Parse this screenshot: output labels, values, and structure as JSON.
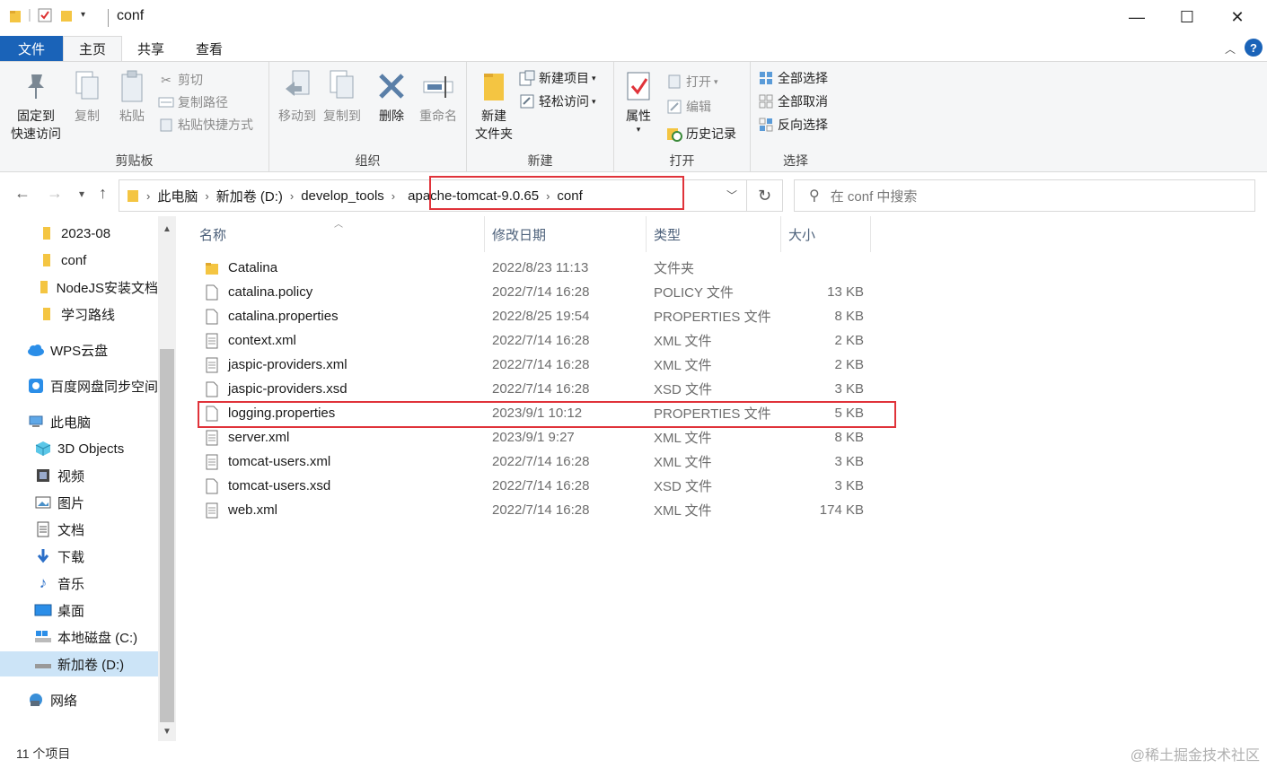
{
  "window": {
    "title": "conf",
    "minimize": "—",
    "maximize": "☐",
    "close": "✕"
  },
  "ribbon_tabs": {
    "file": "文件",
    "home": "主页",
    "share": "共享",
    "view": "查看"
  },
  "ribbon": {
    "clipboard": {
      "label": "剪贴板",
      "pin_line1": "固定到",
      "pin_line2": "快速访问",
      "copy": "复制",
      "paste": "粘贴",
      "cut": "剪切",
      "copy_path": "复制路径",
      "paste_shortcut": "粘贴快捷方式"
    },
    "organize": {
      "label": "组织",
      "move_to": "移动到",
      "copy_to": "复制到",
      "delete": "删除",
      "rename": "重命名"
    },
    "new": {
      "label": "新建",
      "new_folder_line1": "新建",
      "new_folder_line2": "文件夹",
      "new_item": "新建项目",
      "easy_access": "轻松访问"
    },
    "open": {
      "label": "打开",
      "properties": "属性",
      "open": "打开",
      "edit": "编辑",
      "history": "历史记录"
    },
    "select": {
      "label": "选择",
      "select_all": "全部选择",
      "select_none": "全部取消",
      "invert": "反向选择"
    }
  },
  "address": {
    "crumbs": [
      "此电脑",
      "新加卷 (D:)",
      "develop_tools",
      "apache-tomcat-9.0.65",
      "conf"
    ],
    "search_placeholder": "在 conf 中搜索"
  },
  "nav": {
    "items": [
      {
        "label": "2023-08",
        "icon": "folder-icon"
      },
      {
        "label": "conf",
        "icon": "folder-icon"
      },
      {
        "label": "NodeJS安装文档",
        "icon": "folder-icon"
      },
      {
        "label": "学习路线",
        "icon": "folder-icon"
      },
      {
        "label": "WPS云盘",
        "icon": "cloud-icon"
      },
      {
        "label": "百度网盘同步空间",
        "icon": "baidu-icon"
      },
      {
        "label": "此电脑",
        "icon": "computer-icon"
      },
      {
        "label": "3D Objects",
        "icon": "cube-icon"
      },
      {
        "label": "视频",
        "icon": "video-icon"
      },
      {
        "label": "图片",
        "icon": "picture-icon"
      },
      {
        "label": "文档",
        "icon": "document-icon"
      },
      {
        "label": "下载",
        "icon": "download-icon"
      },
      {
        "label": "音乐",
        "icon": "music-icon"
      },
      {
        "label": "桌面",
        "icon": "desktop-icon"
      },
      {
        "label": "本地磁盘 (C:)",
        "icon": "drive-c-icon"
      },
      {
        "label": "新加卷 (D:)",
        "icon": "drive-d-icon"
      },
      {
        "label": "网络",
        "icon": "network-icon"
      }
    ]
  },
  "columns": {
    "name": "名称",
    "date": "修改日期",
    "type": "类型",
    "size": "大小"
  },
  "files": [
    {
      "name": "Catalina",
      "date": "2022/8/23 11:13",
      "type": "文件夹",
      "size": "",
      "kind": "folder"
    },
    {
      "name": "catalina.policy",
      "date": "2022/7/14 16:28",
      "type": "POLICY 文件",
      "size": "13 KB",
      "kind": "file"
    },
    {
      "name": "catalina.properties",
      "date": "2022/8/25 19:54",
      "type": "PROPERTIES 文件",
      "size": "8 KB",
      "kind": "file"
    },
    {
      "name": "context.xml",
      "date": "2022/7/14 16:28",
      "type": "XML 文件",
      "size": "2 KB",
      "kind": "xml"
    },
    {
      "name": "jaspic-providers.xml",
      "date": "2022/7/14 16:28",
      "type": "XML 文件",
      "size": "2 KB",
      "kind": "xml"
    },
    {
      "name": "jaspic-providers.xsd",
      "date": "2022/7/14 16:28",
      "type": "XSD 文件",
      "size": "3 KB",
      "kind": "file"
    },
    {
      "name": "logging.properties",
      "date": "2023/9/1 10:12",
      "type": "PROPERTIES 文件",
      "size": "5 KB",
      "kind": "file"
    },
    {
      "name": "server.xml",
      "date": "2023/9/1 9:27",
      "type": "XML 文件",
      "size": "8 KB",
      "kind": "xml"
    },
    {
      "name": "tomcat-users.xml",
      "date": "2022/7/14 16:28",
      "type": "XML 文件",
      "size": "3 KB",
      "kind": "xml"
    },
    {
      "name": "tomcat-users.xsd",
      "date": "2022/7/14 16:28",
      "type": "XSD 文件",
      "size": "3 KB",
      "kind": "file"
    },
    {
      "name": "web.xml",
      "date": "2022/7/14 16:28",
      "type": "XML 文件",
      "size": "174 KB",
      "kind": "xml"
    }
  ],
  "status": {
    "count": "11 个项目"
  },
  "watermark": "@稀土掘金技术社区",
  "colors": {
    "accent": "#1a63b8",
    "highlight_box": "#e0333a",
    "selection": "#cce4f7",
    "folder": "#f4c542"
  }
}
